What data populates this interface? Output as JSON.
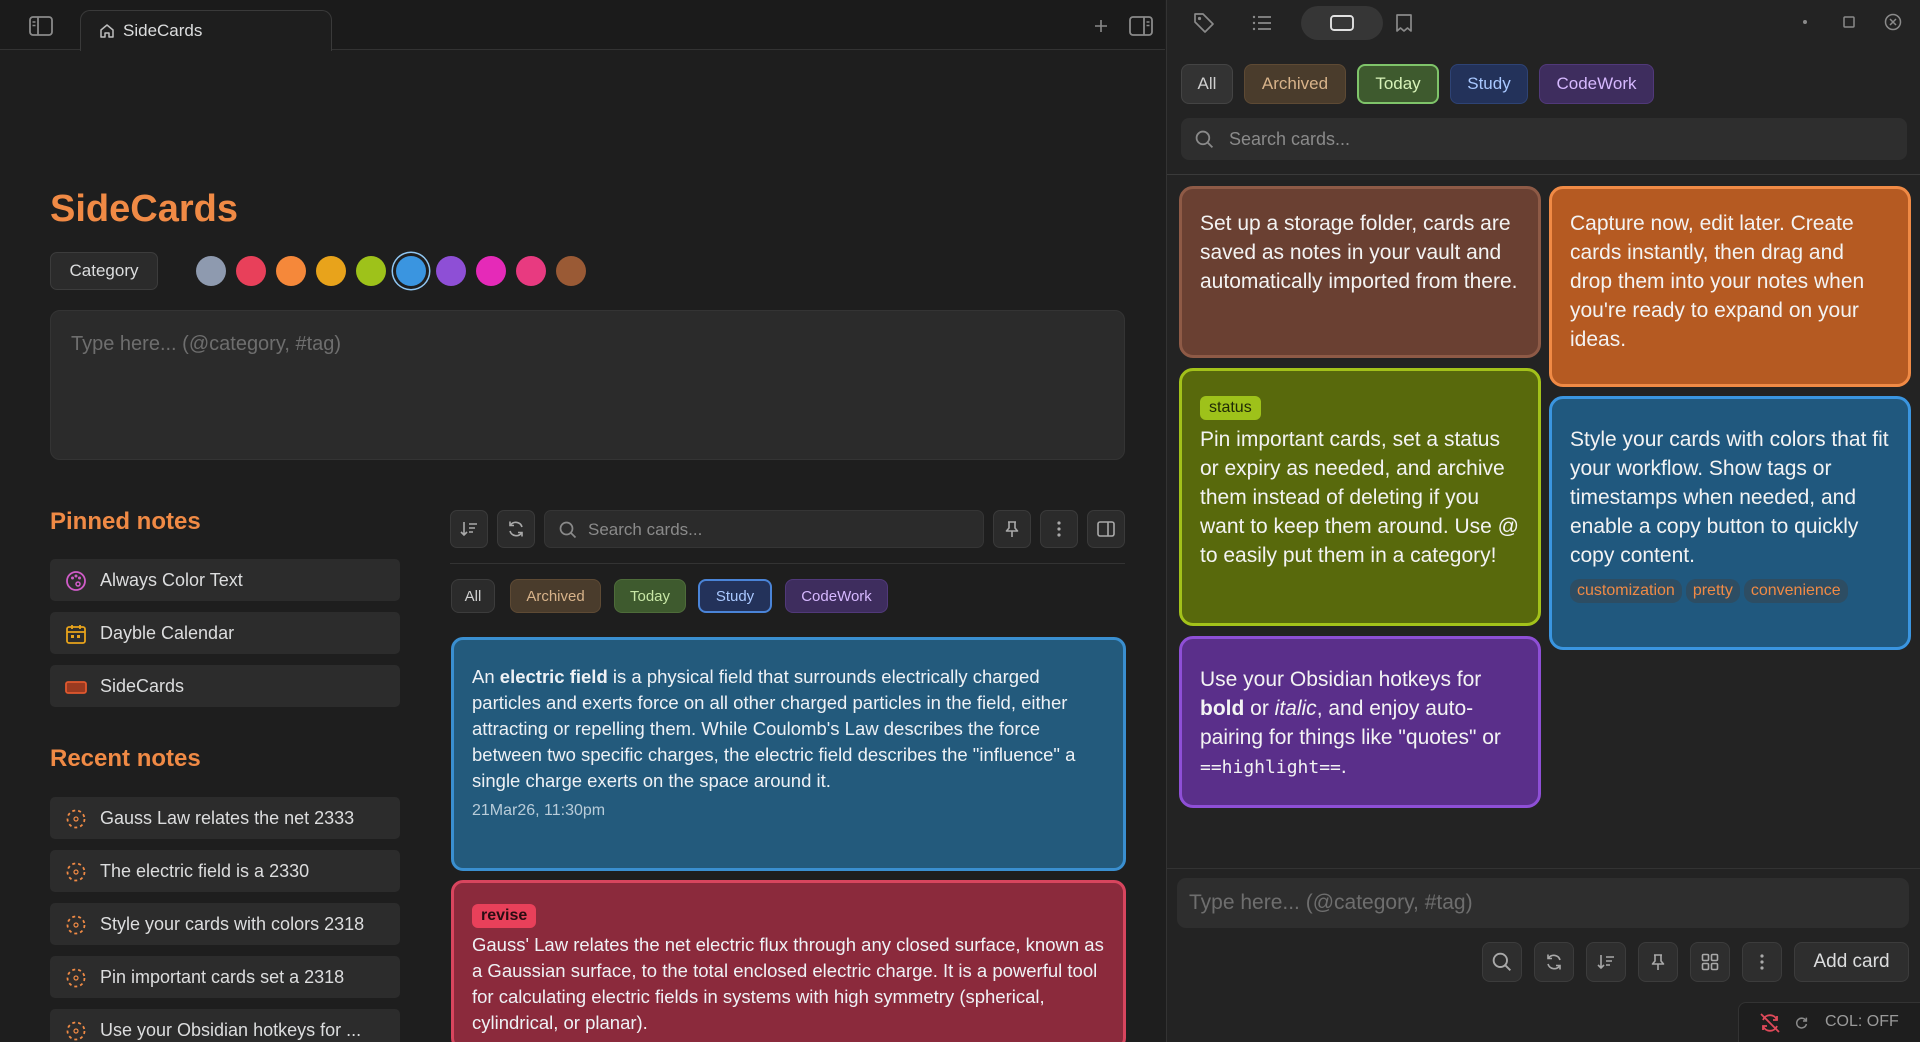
{
  "left": {
    "tab_title": "SideCards",
    "title": "SideCards",
    "category_label": "Category",
    "swatches": [
      "#8e9aaf",
      "#e8405a",
      "#f5883a",
      "#e8a31b",
      "#9ec21a",
      "#3a95e0",
      "#8e4fd6",
      "#e52ab8",
      "#e83a80",
      "#9a5a35"
    ],
    "input_placeholder": "Type here... (@category, #tag)",
    "pinned_heading": "Pinned notes",
    "pinned": [
      {
        "label": "Always Color Text"
      },
      {
        "label": "Dayble Calendar"
      },
      {
        "label": "SideCards"
      }
    ],
    "recent_heading": "Recent notes",
    "recent": [
      {
        "label": "Gauss Law relates the net 2333"
      },
      {
        "label": "The electric field is a 2330"
      },
      {
        "label": "Style your cards with colors 2318"
      },
      {
        "label": "Pin important cards set a 2318"
      },
      {
        "label": "Use your Obsidian hotkeys for ..."
      }
    ],
    "search_placeholder": "Search cards...",
    "filters": [
      {
        "label": "All"
      },
      {
        "label": "Archived"
      },
      {
        "label": "Today"
      },
      {
        "label": "Study"
      },
      {
        "label": "CodeWork"
      }
    ],
    "cards": [
      {
        "p1": "An ",
        "bold": "electric field",
        "p2": " is a physical field that surrounds electrically charged particles and exerts force on all other charged particles in the field, either attracting or repelling them. While Coulomb's Law describes the force between two specific charges, the electric field describes the \"influence\" a single charge exerts on the space around it.",
        "date": "21Mar26, 11:30pm"
      },
      {
        "badge": "revise",
        "text": "Gauss' Law relates the net electric flux through any closed surface, known as a Gaussian surface, to the total enclosed electric charge. It is a powerful tool for calculating electric fields in systems with high symmetry (spherical, cylindrical, or planar)."
      }
    ]
  },
  "right": {
    "filters": [
      {
        "label": "All"
      },
      {
        "label": "Archived"
      },
      {
        "label": "Today"
      },
      {
        "label": "Study"
      },
      {
        "label": "CodeWork"
      }
    ],
    "search_placeholder": "Search cards...",
    "cards": {
      "storage": "Set up a storage folder, cards are saved as notes in your vault and automatically imported from there.",
      "capture": "Capture now, edit later. Create cards instantly, then drag and drop them into your notes when you're ready to expand on your ideas.",
      "pin_badge": "status",
      "pin": "Pin important cards, set a status or expiry as needed, and archive them instead of deleting if you want to keep them around. Use @ to easily put them in a category!",
      "style": "Style your cards with colors that fit your workflow. Show tags or timestamps when needed, and enable a copy button to quickly copy content.",
      "style_tags": [
        "customization",
        "pretty",
        "convenience"
      ],
      "hotkeys_1": "Use your Obsidian hotkeys for ",
      "hotkeys_bold": "bold",
      "hotkeys_2": " or ",
      "hotkeys_italic": "italic",
      "hotkeys_3": ", and enjoy auto-pairing for things like \"quotes\" or ",
      "hotkeys_code": "==highlight==",
      "hotkeys_4": "."
    },
    "input_placeholder": "Type here... (@category, #tag)",
    "add_card_label": "Add card",
    "status_text": "COL: OFF"
  }
}
